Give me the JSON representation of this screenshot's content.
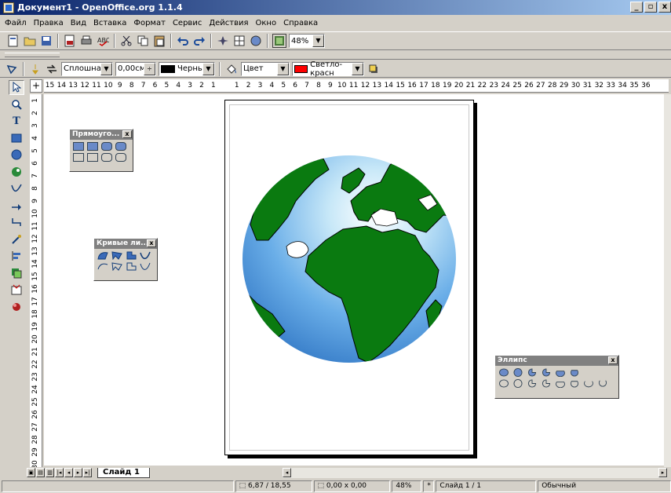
{
  "window": {
    "title": "Документ1 - OpenOffice.org 1.1.4",
    "controls": [
      "_",
      "▫",
      "x"
    ]
  },
  "menu": [
    "Файл",
    "Правка",
    "Вид",
    "Вставка",
    "Формат",
    "Сервис",
    "Действия",
    "Окно",
    "Справка"
  ],
  "toolbar": {
    "zoom": "48%"
  },
  "format_bar": {
    "line_style": "Сплошная",
    "line_width": "0,00см",
    "line_color": "Черный",
    "fill_type": "Цвет",
    "fill_color": "Светло-красн",
    "colors": {
      "line_color": "#000000",
      "fill_color": "#ff0000"
    }
  },
  "ruler": {
    "horizontal": [
      "15",
      "14",
      "13",
      "12",
      "11",
      "10",
      "9",
      "8",
      "7",
      "6",
      "5",
      "4",
      "3",
      "2",
      "1",
      "",
      "1",
      "2",
      "3",
      "4",
      "5",
      "6",
      "7",
      "8",
      "9",
      "10",
      "11",
      "12",
      "13",
      "14",
      "15",
      "16",
      "17",
      "18",
      "19",
      "20",
      "21",
      "22",
      "23",
      "24",
      "25",
      "26",
      "27",
      "28",
      "29",
      "30",
      "31",
      "32",
      "33",
      "34",
      "35",
      "36"
    ],
    "vertical": [
      "1",
      "2",
      "3",
      "4",
      "5",
      "6",
      "7",
      "8",
      "9",
      "10",
      "11",
      "12",
      "13",
      "14",
      "15",
      "16",
      "17",
      "18",
      "19",
      "20",
      "21",
      "22",
      "23",
      "24",
      "25",
      "26",
      "27",
      "28",
      "29",
      "30"
    ]
  },
  "panels": {
    "rectangles": {
      "title": "Прямоуго..."
    },
    "curves": {
      "title": "Кривые ли..."
    },
    "ellipse": {
      "title": "Эллипс"
    }
  },
  "close_glyph": "x",
  "tabs": {
    "slide": "Слайд 1"
  },
  "status": {
    "position": "6,87 / 18,55",
    "size": "0,00 x 0,00",
    "zoom": "48%",
    "modified": "*",
    "slide": "Слайд 1 / 1",
    "layout": "Обычный"
  },
  "icons": [
    "document-icon",
    "open-icon",
    "save-icon",
    "export-pdf-icon",
    "print-icon",
    "spellcheck-icon",
    "cut-icon",
    "copy-icon",
    "paste-icon",
    "undo-icon",
    "redo-icon",
    "navigator-icon",
    "gallery-icon",
    "globe-image"
  ]
}
